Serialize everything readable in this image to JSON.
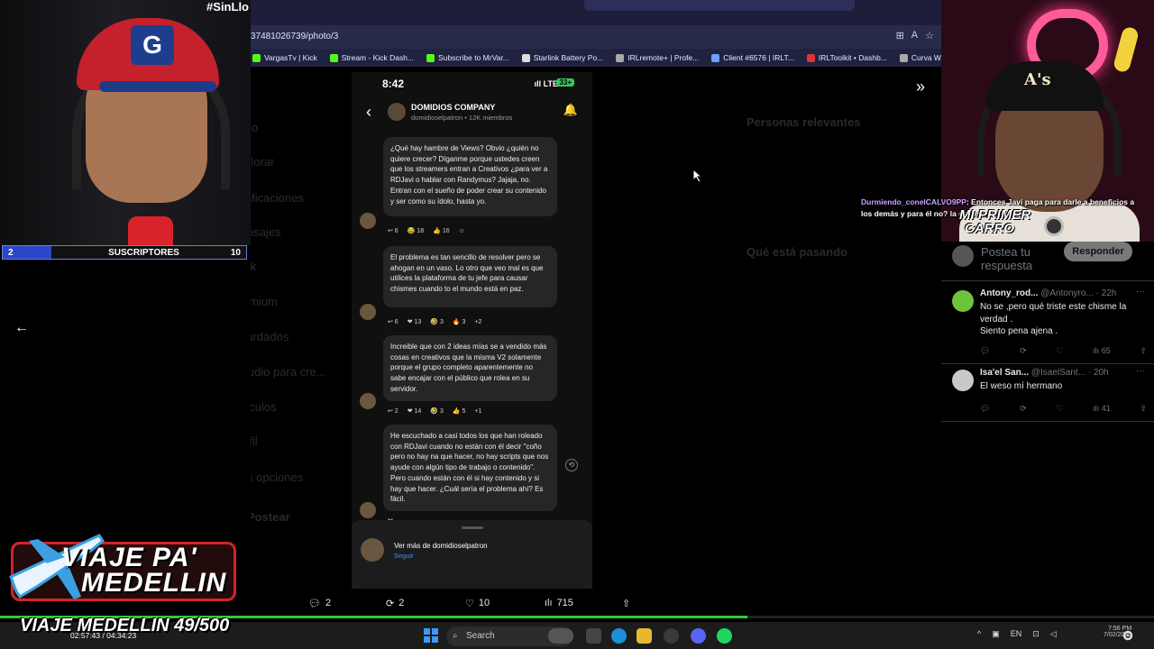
{
  "overlay": {
    "hashtag": "#SinLlo",
    "subscribers": {
      "current": "2",
      "label": "SUSCRIPTORES",
      "goal": "10",
      "progress_fraction": 0.2
    },
    "viaje": {
      "title_line1": "VIAJE PA'",
      "title_line2": "MEDELLIN",
      "goal_text": "VIAJE MEDELLIN 49/500",
      "progress_fraction": 0.648,
      "timecode": "02:57:43 / 04:34:23"
    },
    "chat": {
      "user": "Durmiendo_conelCALVO9PP",
      "message": ": Entonces Javi paga para darle a beneficios a los demás y para él no? la gente anm"
    },
    "banner": {
      "line1": "MI PRIMER",
      "line2": "CARRO"
    },
    "cap_letter_right": "A's",
    "cap_letter_left": "G"
  },
  "browser": {
    "url": "37481026739/photo/3",
    "bookmarks": [
      {
        "label": "VargasTv | Kick",
        "color": "#53fc18"
      },
      {
        "label": "Stream - Kick Dash...",
        "color": "#53fc18"
      },
      {
        "label": "Subscribe to MrVar...",
        "color": "#53fc18"
      },
      {
        "label": "Starlink Battery Po...",
        "color": "#dddddd"
      },
      {
        "label": "IRLremote+ | Profe...",
        "color": "#aaaaaa"
      },
      {
        "label": "Client #6576 | IRLT...",
        "color": "#6aa0ff"
      },
      {
        "label": "IRLToolkit • Dashb...",
        "color": "#e0303a"
      },
      {
        "label": "Curva Wheels CFF76",
        "color": "#aaaaaa"
      }
    ]
  },
  "background_page": {
    "nav": [
      "Inicio",
      "Explorar",
      "Notificaciones",
      "Mensajes",
      "Grok",
      "Premium",
      "Guardados",
      "Estudio para cre...",
      "Artículos",
      "Perfil",
      "Más opciones"
    ],
    "post_button": "Postear",
    "right_heading": "Personas relevantes",
    "happening": "Qué está pasando"
  },
  "phone": {
    "time": "8:42",
    "network": "LTE",
    "battery": "33+",
    "channel_name": "DOMIDIOS COMPANY",
    "channel_sub": "domidioselpatron • 12K miembros",
    "messages": [
      {
        "text": "¿Qué hay hambre de Views? Obvio ¿quién no quiere crecer? Díganme porque ustedes creen que los streamers entran a Creativos ¿para ver a RDJavi o hablar con Randymus? Jajaja, no. Entran con el sueño de poder crear su contenido y ser como su ídolo, hasta yo.",
        "reactions": [
          "↩ 6",
          "😂 18",
          "👍 16",
          "☺"
        ]
      },
      {
        "text": "El problema es tan sencillo de resolver pero se ahogan en un vaso. Lo otro que veo mal es que utilices la plataforma de tu jefe para causar chismes cuando to el mundo está en paz.",
        "reactions": [
          "↩ 6",
          "❤ 13",
          "🤣 3",
          "🔥 3",
          "+2"
        ]
      },
      {
        "text": "Increible que con 2 ideas mías se a vendido más cosas en creativos que la misma V2 solamente porque el grupo completo aparentemente no sabe encajar con el público que rolea en su servidor.",
        "reactions": [
          "↩ 2",
          "❤ 14",
          "🤣 3",
          "👍 5",
          "+1"
        ]
      },
      {
        "text": "He escuchado a casi todos los que han roleado con RDJavi cuando no están con él decir \"coño pero no hay na que hacer, no hay scripts que nos ayude con algún tipo de trabajo o contenido\". Pero cuando están con él si hay contenido y si hay que hacer. ¿Cuál sería el problema ahí? Es fácil.",
        "reactions": [
          "↩"
        ]
      }
    ],
    "footer_more": "Ver más de domidioselpatron",
    "footer_follow": "Seguir"
  },
  "engagement": {
    "replies": "2",
    "reposts": "2",
    "likes": "10",
    "views": "715"
  },
  "replies_panel": {
    "placeholder": "Postea tu respuesta",
    "reply_button": "Responder",
    "tweets": [
      {
        "name": "Antony_rod...",
        "handle": "@Antonyro...",
        "age": "22h",
        "text": "No se ,pero qué triste este chisme la verdad .\nSiento pena ajena .",
        "views": "65",
        "avatar_color": "#6cc43c"
      },
      {
        "name": "Isa'el San...",
        "handle": "@IsaelSant...",
        "age": "20h",
        "text": "El weso mí hermano",
        "views": "41",
        "avatar_color": "#c8c8c8"
      }
    ]
  },
  "taskbar": {
    "search_placeholder": "Search",
    "clock_time": "7:56 PM",
    "clock_date": "7/02/2025",
    "lang": "EN"
  }
}
